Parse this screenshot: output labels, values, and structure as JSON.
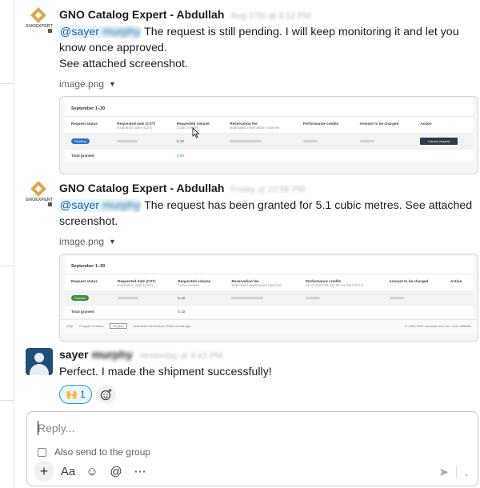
{
  "messages": [
    {
      "sender": "GNO Catalog Expert - Abdullah",
      "timestamp": "Aug 27th at 3:12 PM",
      "mention": "@sayer",
      "mention_surname": "murphy",
      "text": "The request is still pending. I will keep monitoring it and let you know once approved.",
      "text2": "See attached screenshot.",
      "attachment_name": "image.png",
      "avatar_text": "GNOEXPERT"
    },
    {
      "sender": "GNO Catalog Expert - Abdullah",
      "timestamp": "Friday at 10:56 PM",
      "mention": "@sayer",
      "mention_surname": "murphy",
      "text": "The request has been granted for 5.1 cubic metres. See attached screenshot.",
      "attachment_name": "image.png",
      "avatar_text": "GNOEXPERT"
    },
    {
      "sender": "sayer",
      "sender_surname": "murphy",
      "timestamp": "Yesterday at 4:43 PM",
      "text": "Perfect. I made the shipment successfully!",
      "reaction_emoji": "🙌",
      "reaction_count": "1"
    }
  ],
  "shot1": {
    "title": "September 1–30",
    "headers": [
      "Request status",
      "Requested date (CST)",
      "Requested volume",
      "Reservation fee",
      "Performance credits",
      "Amount to be charged",
      "Action"
    ],
    "subheaders": [
      "",
      "Expiration date (CST)",
      "Cubic metres",
      "Estimated reservation total fee",
      "",
      "",
      ""
    ],
    "status": "Pending",
    "volume": "5.10",
    "action": "Cancel request",
    "total_label": "Total granted",
    "total_value": "0.00"
  },
  "shot2": {
    "title": "September 1–30",
    "headers": [
      "Request status",
      "Requested date (CST)",
      "Requested volume",
      "Reservation fee",
      "Performance credits",
      "Amount to be charged",
      "Action"
    ],
    "subheaders": [
      "",
      "Expiration date (CST)",
      "Cubic metres",
      "Estimated reservation total fee",
      "As of 2024-09-18, 05:14 AM GMT-4",
      "",
      ""
    ],
    "status": "Granted",
    "volume": "5.10",
    "total_label": "Total granted",
    "total_value": "5.10",
    "footer_help": "Help",
    "footer_policies": "Program Policies",
    "footer_lang": "English",
    "footer_app": "Download the Amazon Seller mobile app",
    "footer_copy": "© 1999-2024, Amazon.com, Inc. or its affiliates"
  },
  "composer": {
    "placeholder": "Reply...",
    "also_send": "Also send to the group"
  },
  "colors": {
    "mention": "#1264a3",
    "mention_bg": "#e8f5fa",
    "reaction_border": "#1d9bd1",
    "pending_pill": "#2e73c7",
    "granted_pill": "#3f8e3f",
    "avatar_bg": "#1f4e79"
  },
  "icons": {
    "plus": "plus-icon",
    "format": "format-text-icon",
    "emoji": "emoji-icon",
    "mention": "at-mention-icon",
    "more": "more-icon",
    "send": "send-icon",
    "chevron": "chevron-down-icon"
  }
}
